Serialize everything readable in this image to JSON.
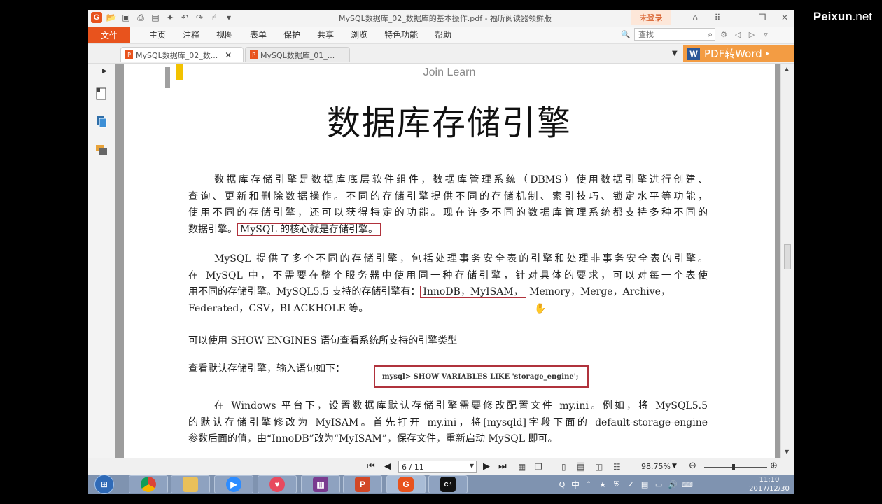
{
  "watermark": {
    "brand": "Peixun",
    "suffix": ".net"
  },
  "window": {
    "title": "MySQL数据库_02_数据库的基本操作.pdf - 福昕阅读器领鲜版",
    "login_label": "未登录"
  },
  "menubar": {
    "file_label": "文件",
    "items": [
      "主页",
      "注释",
      "视图",
      "表单",
      "保护",
      "共享",
      "浏览",
      "特色功能",
      "帮助"
    ],
    "search_placeholder": "查找"
  },
  "tabs": [
    {
      "label": "MySQL数据库_02_数...",
      "active": true
    },
    {
      "label": "MySQL数据库_01_...",
      "active": false
    }
  ],
  "convert_button": {
    "icon_letter": "W",
    "label": "PDF转Word"
  },
  "document": {
    "header_text": "Join Learn",
    "title": "数据库存储引擎",
    "p1": {
      "l1": "数据库存储引擎是数据库底层软件组件，数据库管理系统（DBMS）使用数据引擎进行创建、",
      "l2": "查询、更新和删除数据操作。不同的存储引擎提供不同的存储机制、索引技巧、锁定水平等功能，",
      "l3": "使用不同的存储引擎，还可以获得特定的功能。现在许多不同的数据库管理系统都支持多种不同的",
      "l4_pre": "数据引擎。",
      "l4_box": "MySQL 的核心就是存储引擎。"
    },
    "p2": {
      "l1": "MySQL 提供了多个不同的存储引擎，包括处理事务安全表的引擎和处理非事务安全表的引擎。",
      "l2": "在 MySQL 中，不需要在整个服务器中使用同一种存储引擎，针对具体的要求，可以对每一个表使",
      "l3_pre": "用不同的存储引擎。MySQL5.5 支持的存储引擎有：",
      "l3_box": "InnoDB，MyISAM，",
      "l3_post": "Memory，Merge，Archive，",
      "l4": "Federated，CSV，BLACKHOLE 等。"
    },
    "p3": "可以使用 SHOW ENGINES 语句查看系统所支持的引擎类型",
    "p4_label": "查看默认存储引擎，输入语句如下：",
    "p4_command": "mysql> SHOW VARIABLES LIKE 'storage_engine';",
    "p5": {
      "l1": "在 Windows 平台下，设置数据库默认存储引擎需要修改配置文件 my.ini。例如，将 MySQL5.5",
      "l2": "的默认存储引擎修改为 MyISAM。首先打开 my.ini，将[mysqld]字段下面的 default-storage-engine",
      "l3": "参数后面的值，由“InnoDB”改为“MyISAM”，保存文件，重新启动 MySQL 即可。"
    }
  },
  "statusbar": {
    "page_indicator": "6 / 11",
    "zoom": "98.75%"
  },
  "taskbar": {
    "apps": [
      "chrome",
      "file-explorer",
      "zoom-meeting",
      "heart-app",
      "winrar",
      "powerpoint",
      "foxit-reader",
      "command-prompt"
    ],
    "ime": "中",
    "clock_time": "11:10",
    "clock_date": "2017/12/30"
  }
}
